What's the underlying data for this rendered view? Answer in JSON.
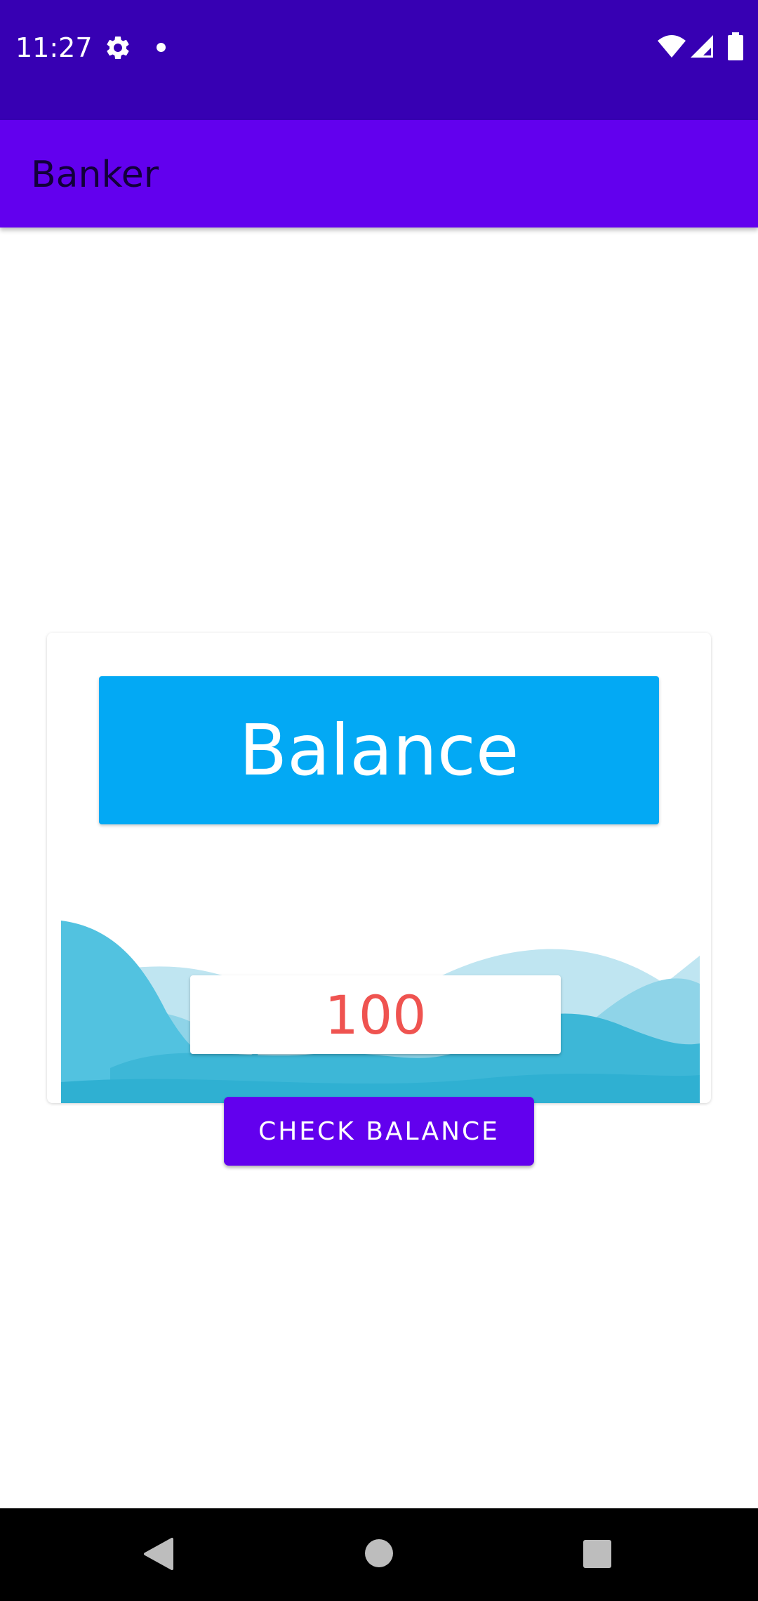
{
  "status_bar": {
    "time": "11:27",
    "icons": [
      "gear-icon",
      "notification-dot-icon",
      "wifi-icon",
      "cell-signal-icon",
      "battery-icon"
    ]
  },
  "app_bar": {
    "title": "Banker"
  },
  "card": {
    "header_label": "Balance",
    "amount": "100"
  },
  "check_button": {
    "label": "CHECK BALANCE"
  },
  "nav_bar": {
    "icons": [
      "back-icon",
      "home-icon",
      "recents-icon"
    ]
  },
  "colors": {
    "status_bar": "#3700b3",
    "app_bar": "#6200ee",
    "header": "#03a9f4",
    "amount_text": "#ef5350",
    "button": "#6200ee"
  }
}
